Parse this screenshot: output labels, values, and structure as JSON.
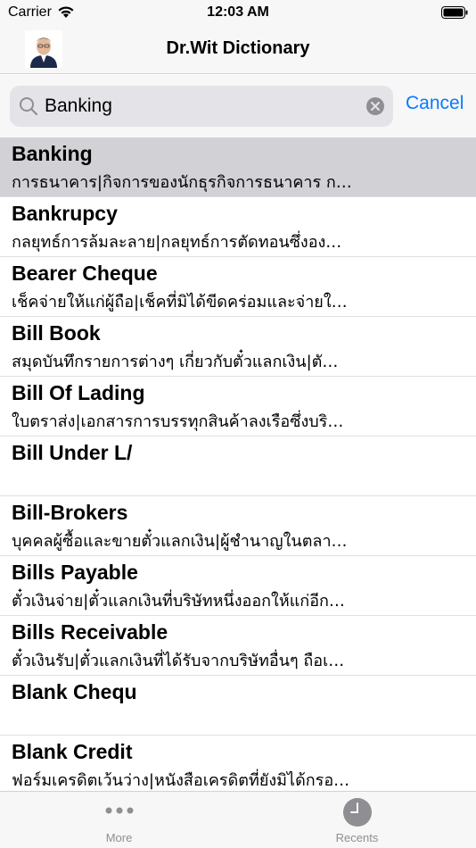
{
  "status_bar": {
    "carrier": "Carrier",
    "time": "12:03 AM"
  },
  "nav": {
    "title": "Dr.Wit Dictionary"
  },
  "search": {
    "value": "Banking",
    "cancel_label": "Cancel"
  },
  "results": [
    {
      "term": "Banking",
      "meaning": "การธนาคาร|กิจการของนักธุรกิจการธนาคาร ก…"
    },
    {
      "term": "Bankrupcy",
      "meaning": "กลยุทธ์การล้มละลาย|กลยุทธ์การตัดทอนซึ่งอง…"
    },
    {
      "term": "Bearer Cheque",
      "meaning": "เช็คจ่ายให้แก่ผู้ถือ|เช็คที่มิได้ขีดคร่อมและจ่ายใ…"
    },
    {
      "term": "Bill Book",
      "meaning": "สมุดบันทึกรายการต่างๆ เกี่ยวกับตั๋วแลกเงิน|ตั…"
    },
    {
      "term": "Bill Of Lading",
      "meaning": "ใบตราส่ง|เอกสารการบรรทุกสินค้าลงเรือซึ่งบริ…"
    },
    {
      "term": "Bill Under L/",
      "meaning": ""
    },
    {
      "term": "Bill-Brokers",
      "meaning": "บุคคลผู้ซื้อและขายตั๋วแลกเงิน|ผู้ชำนาญในตลา…"
    },
    {
      "term": "Bills Payable",
      "meaning": "ตั๋วเงินจ่าย|ตั๋วแลกเงินที่บริษัทหนึ่งออกให้แก่อีก…"
    },
    {
      "term": "Bills Receivable",
      "meaning": "ตั๋วเงินรับ|ตั๋วแลกเงินที่ได้รับจากบริษัทอื่นๆ ถือเ…"
    },
    {
      "term": "Blank Chequ",
      "meaning": ""
    },
    {
      "term": "Blank Credit",
      "meaning": "ฟอร์มเครดิตเว้นว่าง|หนังสือเครดิตที่ยังมิได้กรอ…"
    }
  ],
  "tabs": {
    "more_label": "More",
    "recents_label": "Recents"
  },
  "colors": {
    "accent": "#0a7aff",
    "selected_row": "#d1d1d6",
    "bar_background": "#f7f7f7"
  },
  "icons": [
    "wifi-icon",
    "battery-icon",
    "search-icon",
    "clear-icon",
    "more-icon",
    "clock-icon"
  ]
}
